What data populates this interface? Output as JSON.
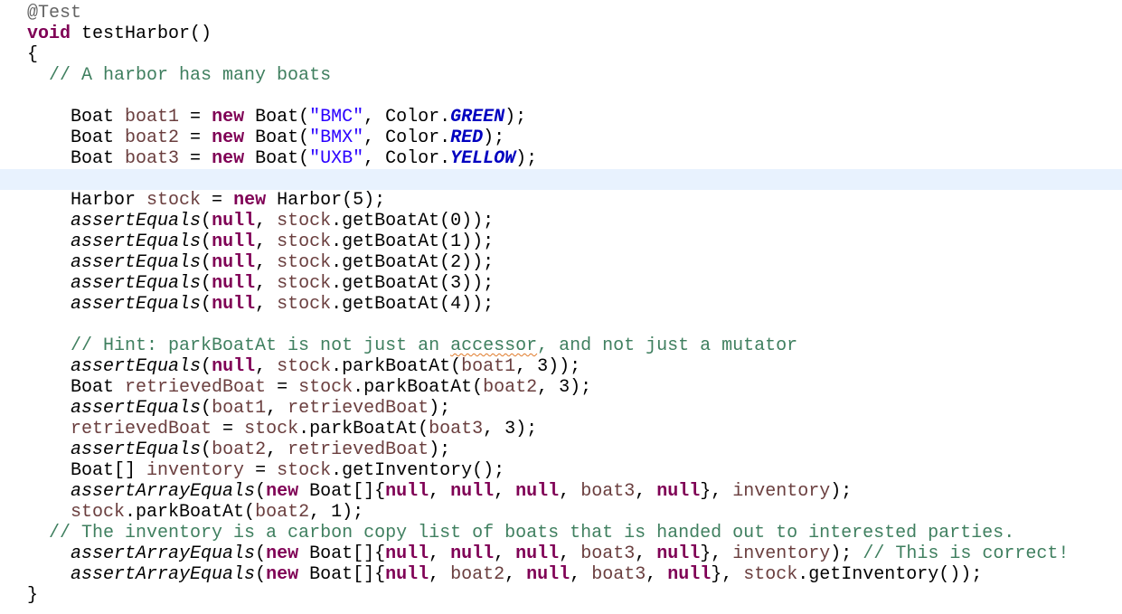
{
  "editor": {
    "language": "java",
    "current_line": 8,
    "colors": {
      "keyword": "#7F0055",
      "comment": "#3F7F5F",
      "string": "#2A00FF",
      "static_field": "#0000C0",
      "local_variable": "#6A3E3E",
      "annotation": "#646464",
      "current_line_highlight": "#E8F2FE"
    },
    "lines": [
      {
        "indent": 0,
        "tokens": [
          {
            "t": "@Test",
            "c": "an"
          }
        ]
      },
      {
        "indent": 0,
        "tokens": [
          {
            "t": "void",
            "c": "kw"
          },
          {
            "t": " testHarbor()",
            "c": ""
          }
        ]
      },
      {
        "indent": 0,
        "tokens": [
          {
            "t": "{",
            "c": ""
          }
        ]
      },
      {
        "indent": 2,
        "tokens": [
          {
            "t": "// A harbor has many boats",
            "c": "cm"
          }
        ]
      },
      {
        "indent": 0,
        "tokens": []
      },
      {
        "indent": 4,
        "tokens": [
          {
            "t": "Boat ",
            "c": ""
          },
          {
            "t": "boat1",
            "c": "lv"
          },
          {
            "t": " = ",
            "c": ""
          },
          {
            "t": "new",
            "c": "kw"
          },
          {
            "t": " Boat(",
            "c": ""
          },
          {
            "t": "\"BMC\"",
            "c": "str"
          },
          {
            "t": ", Color.",
            "c": ""
          },
          {
            "t": "GREEN",
            "c": "sf"
          },
          {
            "t": ");",
            "c": ""
          }
        ]
      },
      {
        "indent": 4,
        "tokens": [
          {
            "t": "Boat ",
            "c": ""
          },
          {
            "t": "boat2",
            "c": "lv"
          },
          {
            "t": " = ",
            "c": ""
          },
          {
            "t": "new",
            "c": "kw"
          },
          {
            "t": " Boat(",
            "c": ""
          },
          {
            "t": "\"BMX\"",
            "c": "str"
          },
          {
            "t": ", Color.",
            "c": ""
          },
          {
            "t": "RED",
            "c": "sf"
          },
          {
            "t": ");",
            "c": ""
          }
        ]
      },
      {
        "indent": 4,
        "tokens": [
          {
            "t": "Boat ",
            "c": ""
          },
          {
            "t": "boat3",
            "c": "lv"
          },
          {
            "t": " = ",
            "c": ""
          },
          {
            "t": "new",
            "c": "kw"
          },
          {
            "t": " Boat(",
            "c": ""
          },
          {
            "t": "\"UXB\"",
            "c": "str"
          },
          {
            "t": ", Color.",
            "c": ""
          },
          {
            "t": "YELLOW",
            "c": "sf"
          },
          {
            "t": ");",
            "c": ""
          }
        ]
      },
      {
        "indent": 0,
        "tokens": []
      },
      {
        "indent": 4,
        "tokens": [
          {
            "t": "Harbor ",
            "c": ""
          },
          {
            "t": "stock",
            "c": "lv"
          },
          {
            "t": " = ",
            "c": ""
          },
          {
            "t": "new",
            "c": "kw"
          },
          {
            "t": " Harbor(5);",
            "c": ""
          }
        ]
      },
      {
        "indent": 4,
        "tokens": [
          {
            "t": "assertEquals",
            "c": "it"
          },
          {
            "t": "(",
            "c": ""
          },
          {
            "t": "null",
            "c": "kw"
          },
          {
            "t": ", ",
            "c": ""
          },
          {
            "t": "stock",
            "c": "lv"
          },
          {
            "t": ".getBoatAt(0));",
            "c": ""
          }
        ]
      },
      {
        "indent": 4,
        "tokens": [
          {
            "t": "assertEquals",
            "c": "it"
          },
          {
            "t": "(",
            "c": ""
          },
          {
            "t": "null",
            "c": "kw"
          },
          {
            "t": ", ",
            "c": ""
          },
          {
            "t": "stock",
            "c": "lv"
          },
          {
            "t": ".getBoatAt(1));",
            "c": ""
          }
        ]
      },
      {
        "indent": 4,
        "tokens": [
          {
            "t": "assertEquals",
            "c": "it"
          },
          {
            "t": "(",
            "c": ""
          },
          {
            "t": "null",
            "c": "kw"
          },
          {
            "t": ", ",
            "c": ""
          },
          {
            "t": "stock",
            "c": "lv"
          },
          {
            "t": ".getBoatAt(2));",
            "c": ""
          }
        ]
      },
      {
        "indent": 4,
        "tokens": [
          {
            "t": "assertEquals",
            "c": "it"
          },
          {
            "t": "(",
            "c": ""
          },
          {
            "t": "null",
            "c": "kw"
          },
          {
            "t": ", ",
            "c": ""
          },
          {
            "t": "stock",
            "c": "lv"
          },
          {
            "t": ".getBoatAt(3));",
            "c": ""
          }
        ]
      },
      {
        "indent": 4,
        "tokens": [
          {
            "t": "assertEquals",
            "c": "it"
          },
          {
            "t": "(",
            "c": ""
          },
          {
            "t": "null",
            "c": "kw"
          },
          {
            "t": ", ",
            "c": ""
          },
          {
            "t": "stock",
            "c": "lv"
          },
          {
            "t": ".getBoatAt(4));",
            "c": ""
          }
        ]
      },
      {
        "indent": 0,
        "tokens": []
      },
      {
        "indent": 4,
        "tokens": [
          {
            "t": "// Hint: parkBoatAt is not just an ",
            "c": "cm"
          },
          {
            "t": "accessor",
            "c": "cm spell"
          },
          {
            "t": ", and not just a mutator",
            "c": "cm"
          }
        ]
      },
      {
        "indent": 4,
        "tokens": [
          {
            "t": "assertEquals",
            "c": "it"
          },
          {
            "t": "(",
            "c": ""
          },
          {
            "t": "null",
            "c": "kw"
          },
          {
            "t": ", ",
            "c": ""
          },
          {
            "t": "stock",
            "c": "lv"
          },
          {
            "t": ".parkBoatAt(",
            "c": ""
          },
          {
            "t": "boat1",
            "c": "lv"
          },
          {
            "t": ", 3));",
            "c": ""
          }
        ]
      },
      {
        "indent": 4,
        "tokens": [
          {
            "t": "Boat ",
            "c": ""
          },
          {
            "t": "retrievedBoat",
            "c": "lv"
          },
          {
            "t": " = ",
            "c": ""
          },
          {
            "t": "stock",
            "c": "lv"
          },
          {
            "t": ".parkBoatAt(",
            "c": ""
          },
          {
            "t": "boat2",
            "c": "lv"
          },
          {
            "t": ", 3);",
            "c": ""
          }
        ]
      },
      {
        "indent": 4,
        "tokens": [
          {
            "t": "assertEquals",
            "c": "it"
          },
          {
            "t": "(",
            "c": ""
          },
          {
            "t": "boat1",
            "c": "lv"
          },
          {
            "t": ", ",
            "c": ""
          },
          {
            "t": "retrievedBoat",
            "c": "lv"
          },
          {
            "t": ");",
            "c": ""
          }
        ]
      },
      {
        "indent": 4,
        "tokens": [
          {
            "t": "retrievedBoat",
            "c": "lv"
          },
          {
            "t": " = ",
            "c": ""
          },
          {
            "t": "stock",
            "c": "lv"
          },
          {
            "t": ".parkBoatAt(",
            "c": ""
          },
          {
            "t": "boat3",
            "c": "lv"
          },
          {
            "t": ", 3);",
            "c": ""
          }
        ]
      },
      {
        "indent": 4,
        "tokens": [
          {
            "t": "assertEquals",
            "c": "it"
          },
          {
            "t": "(",
            "c": ""
          },
          {
            "t": "boat2",
            "c": "lv"
          },
          {
            "t": ", ",
            "c": ""
          },
          {
            "t": "retrievedBoat",
            "c": "lv"
          },
          {
            "t": ");",
            "c": ""
          }
        ]
      },
      {
        "indent": 4,
        "tokens": [
          {
            "t": "Boat[] ",
            "c": ""
          },
          {
            "t": "inventory",
            "c": "lv"
          },
          {
            "t": " = ",
            "c": ""
          },
          {
            "t": "stock",
            "c": "lv"
          },
          {
            "t": ".getInventory();",
            "c": ""
          }
        ]
      },
      {
        "indent": 4,
        "tokens": [
          {
            "t": "assertArrayEquals",
            "c": "it"
          },
          {
            "t": "(",
            "c": ""
          },
          {
            "t": "new",
            "c": "kw"
          },
          {
            "t": " Boat[]{",
            "c": ""
          },
          {
            "t": "null",
            "c": "kw"
          },
          {
            "t": ", ",
            "c": ""
          },
          {
            "t": "null",
            "c": "kw"
          },
          {
            "t": ", ",
            "c": ""
          },
          {
            "t": "null",
            "c": "kw"
          },
          {
            "t": ", ",
            "c": ""
          },
          {
            "t": "boat3",
            "c": "lv"
          },
          {
            "t": ", ",
            "c": ""
          },
          {
            "t": "null",
            "c": "kw"
          },
          {
            "t": "}, ",
            "c": ""
          },
          {
            "t": "inventory",
            "c": "lv"
          },
          {
            "t": ");",
            "c": ""
          }
        ]
      },
      {
        "indent": 4,
        "tokens": [
          {
            "t": "stock",
            "c": "lv"
          },
          {
            "t": ".parkBoatAt(",
            "c": ""
          },
          {
            "t": "boat2",
            "c": "lv"
          },
          {
            "t": ", 1);",
            "c": ""
          }
        ]
      },
      {
        "indent": 2,
        "tokens": [
          {
            "t": "// The inventory is a carbon copy list of boats that is handed out to interested parties.",
            "c": "cm"
          }
        ]
      },
      {
        "indent": 4,
        "tokens": [
          {
            "t": "assertArrayEquals",
            "c": "it"
          },
          {
            "t": "(",
            "c": ""
          },
          {
            "t": "new",
            "c": "kw"
          },
          {
            "t": " Boat[]{",
            "c": ""
          },
          {
            "t": "null",
            "c": "kw"
          },
          {
            "t": ", ",
            "c": ""
          },
          {
            "t": "null",
            "c": "kw"
          },
          {
            "t": ", ",
            "c": ""
          },
          {
            "t": "null",
            "c": "kw"
          },
          {
            "t": ", ",
            "c": ""
          },
          {
            "t": "boat3",
            "c": "lv"
          },
          {
            "t": ", ",
            "c": ""
          },
          {
            "t": "null",
            "c": "kw"
          },
          {
            "t": "}, ",
            "c": ""
          },
          {
            "t": "inventory",
            "c": "lv"
          },
          {
            "t": "); ",
            "c": ""
          },
          {
            "t": "// This is correct!",
            "c": "cm"
          }
        ]
      },
      {
        "indent": 4,
        "tokens": [
          {
            "t": "assertArrayEquals",
            "c": "it"
          },
          {
            "t": "(",
            "c": ""
          },
          {
            "t": "new",
            "c": "kw"
          },
          {
            "t": " Boat[]{",
            "c": ""
          },
          {
            "t": "null",
            "c": "kw"
          },
          {
            "t": ", ",
            "c": ""
          },
          {
            "t": "boat2",
            "c": "lv"
          },
          {
            "t": ", ",
            "c": ""
          },
          {
            "t": "null",
            "c": "kw"
          },
          {
            "t": ", ",
            "c": ""
          },
          {
            "t": "boat3",
            "c": "lv"
          },
          {
            "t": ", ",
            "c": ""
          },
          {
            "t": "null",
            "c": "kw"
          },
          {
            "t": "}, ",
            "c": ""
          },
          {
            "t": "stock",
            "c": "lv"
          },
          {
            "t": ".getInventory());",
            "c": ""
          }
        ]
      },
      {
        "indent": 0,
        "tokens": [
          {
            "t": "}",
            "c": ""
          }
        ]
      }
    ]
  }
}
